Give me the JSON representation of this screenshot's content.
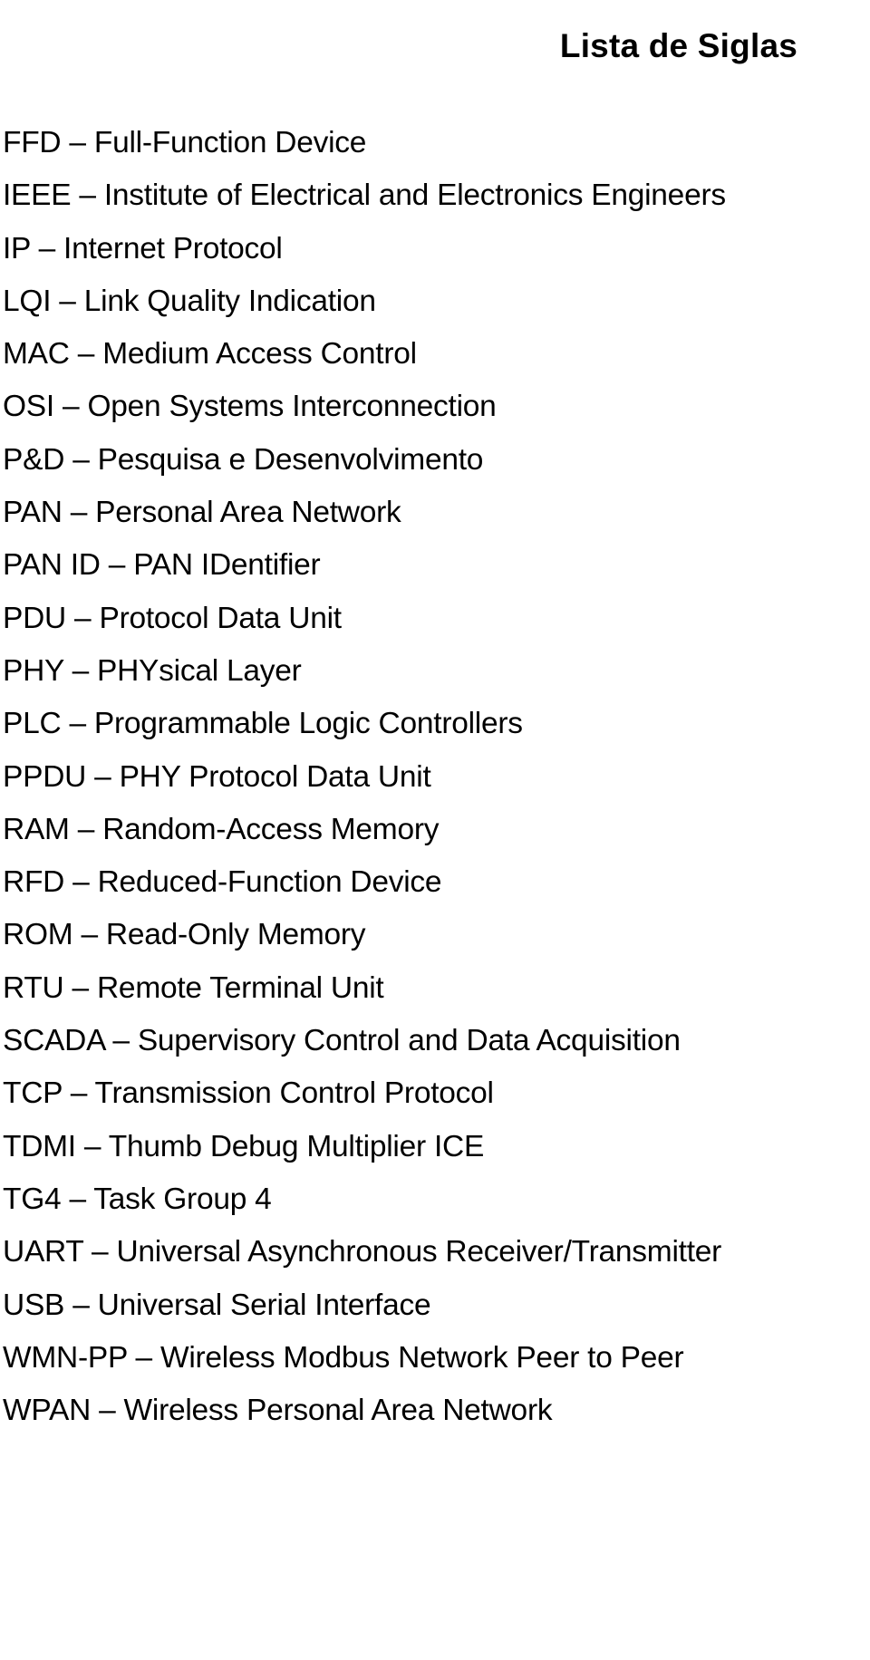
{
  "document": {
    "title": "Lista de Siglas",
    "background_color": "#ffffff",
    "text_color": "#000000"
  },
  "acronyms": [
    {
      "line": "FFD – Full-Function Device"
    },
    {
      "line": "IEEE – Institute of Electrical and Electronics Engineers"
    },
    {
      "line": "IP – Internet Protocol"
    },
    {
      "line": "LQI – Link Quality Indication"
    },
    {
      "line": "MAC – Medium Access Control"
    },
    {
      "line": "OSI – Open Systems Interconnection"
    },
    {
      "line": "P&D – Pesquisa e Desenvolvimento"
    },
    {
      "line": "PAN – Personal Area Network"
    },
    {
      "line": "PAN ID – PAN IDentifier"
    },
    {
      "line": "PDU – Protocol Data Unit"
    },
    {
      "line": "PHY – PHYsical Layer"
    },
    {
      "line": "PLC – Programmable Logic Controllers"
    },
    {
      "line": "PPDU – PHY Protocol Data Unit"
    },
    {
      "line": "RAM – Random-Access Memory"
    },
    {
      "line": "RFD – Reduced-Function Device"
    },
    {
      "line": "ROM – Read-Only Memory"
    },
    {
      "line": "RTU – Remote Terminal Unit"
    },
    {
      "line": "SCADA – Supervisory Control and Data Acquisition"
    },
    {
      "line": "TCP – Transmission Control Protocol"
    },
    {
      "line": "TDMI – Thumb Debug Multiplier ICE"
    },
    {
      "line": "TG4 – Task Group 4"
    },
    {
      "line": "UART – Universal Asynchronous Receiver/Transmitter"
    },
    {
      "line": "USB – Universal Serial Interface"
    },
    {
      "line": "WMN-PP – Wireless Modbus Network Peer to Peer"
    },
    {
      "line": "WPAN – Wireless Personal Area Network"
    }
  ]
}
